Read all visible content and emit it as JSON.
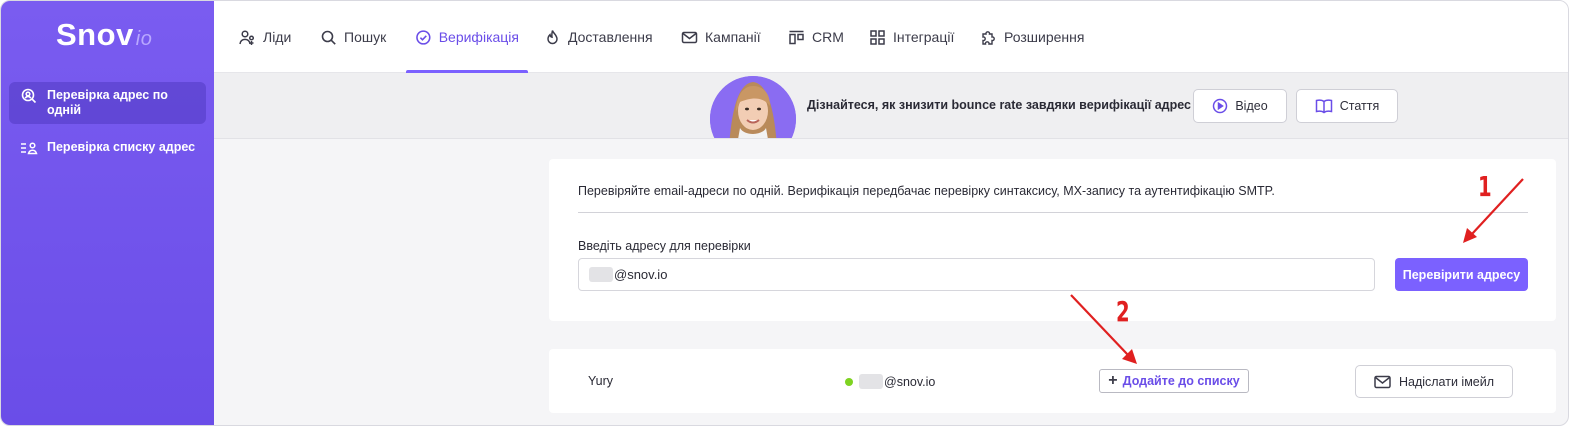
{
  "brand": {
    "name": "Snov",
    "suffix": "io"
  },
  "sidebar": {
    "items": [
      {
        "label": "Перевірка адрес по одній",
        "icon": "search-user-icon",
        "active": true
      },
      {
        "label": "Перевірка списку адрес",
        "icon": "list-user-icon",
        "active": false
      }
    ]
  },
  "nav": {
    "items": [
      {
        "label": "Ліди",
        "icon": "users-icon"
      },
      {
        "label": "Пошук",
        "icon": "search-icon"
      },
      {
        "label": "Верифікація",
        "icon": "check-circle-icon",
        "active": true
      },
      {
        "label": "Доставлення",
        "icon": "flame-icon"
      },
      {
        "label": "Кампанії",
        "icon": "mail-icon"
      },
      {
        "label": "CRM",
        "icon": "crm-icon"
      },
      {
        "label": "Інтеграції",
        "icon": "grid-icon"
      },
      {
        "label": "Розширення",
        "icon": "puzzle-icon"
      }
    ]
  },
  "banner": {
    "text": "Дізнайтеся, як знизити bounce rate завдяки верифікації адрес",
    "video_label": "Відео",
    "article_label": "Стаття"
  },
  "verify": {
    "description": "Перевіряйте email-адреси по одній. Верифікація передбачає перевірку синтаксису, MX-запису та аутентифікацію SMTP.",
    "input_label": "Введіть адресу для перевірки",
    "input_value": "@snov.io",
    "submit_label": "Перевірити адресу"
  },
  "result": {
    "name": "Yury",
    "email": "@snov.io",
    "status_color": "#7ed321",
    "add_label": "Додайте до списку",
    "send_label": "Надіслати імейл"
  },
  "annotations": {
    "marker_1": "1",
    "marker_2": "2",
    "color": "#e02020"
  },
  "colors": {
    "accent": "#7b61ff",
    "sidebar": "#6a4de8"
  }
}
